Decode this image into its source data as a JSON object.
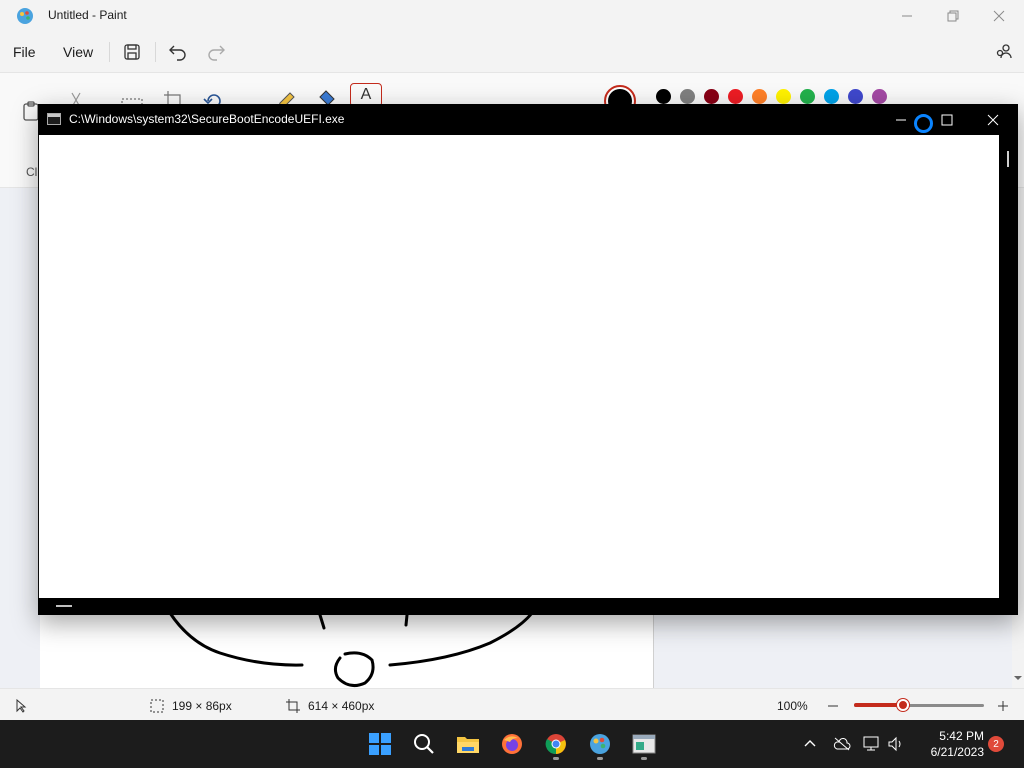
{
  "paint": {
    "title": "Untitled - Paint",
    "menu": {
      "file": "File",
      "view": "View"
    },
    "ribbon": {
      "clipboard_label": "Cl",
      "text_tool_label": "A",
      "palette": [
        "#000000",
        "#7f7f7f",
        "#880015",
        "#ed1c24",
        "#ff7f27",
        "#fff200",
        "#22b14c",
        "#00a2e8",
        "#3f48cc",
        "#a349a4"
      ],
      "current_color": "#000000"
    },
    "status": {
      "selection_size": "199 × 86px",
      "canvas_size": "614 × 460px",
      "zoom": "100%",
      "zoom_fraction": 0.38
    }
  },
  "console": {
    "title": "C:\\Windows\\system32\\SecureBootEncodeUEFI.exe"
  },
  "taskbar": {
    "apps": [
      "start-icon",
      "search-icon",
      "file-explorer-icon",
      "firefox-icon",
      "chrome-icon",
      "paint-icon",
      "console-app-icon"
    ],
    "clock_time": "5:42 PM",
    "clock_date": "6/21/2023",
    "notification_count": "2"
  }
}
